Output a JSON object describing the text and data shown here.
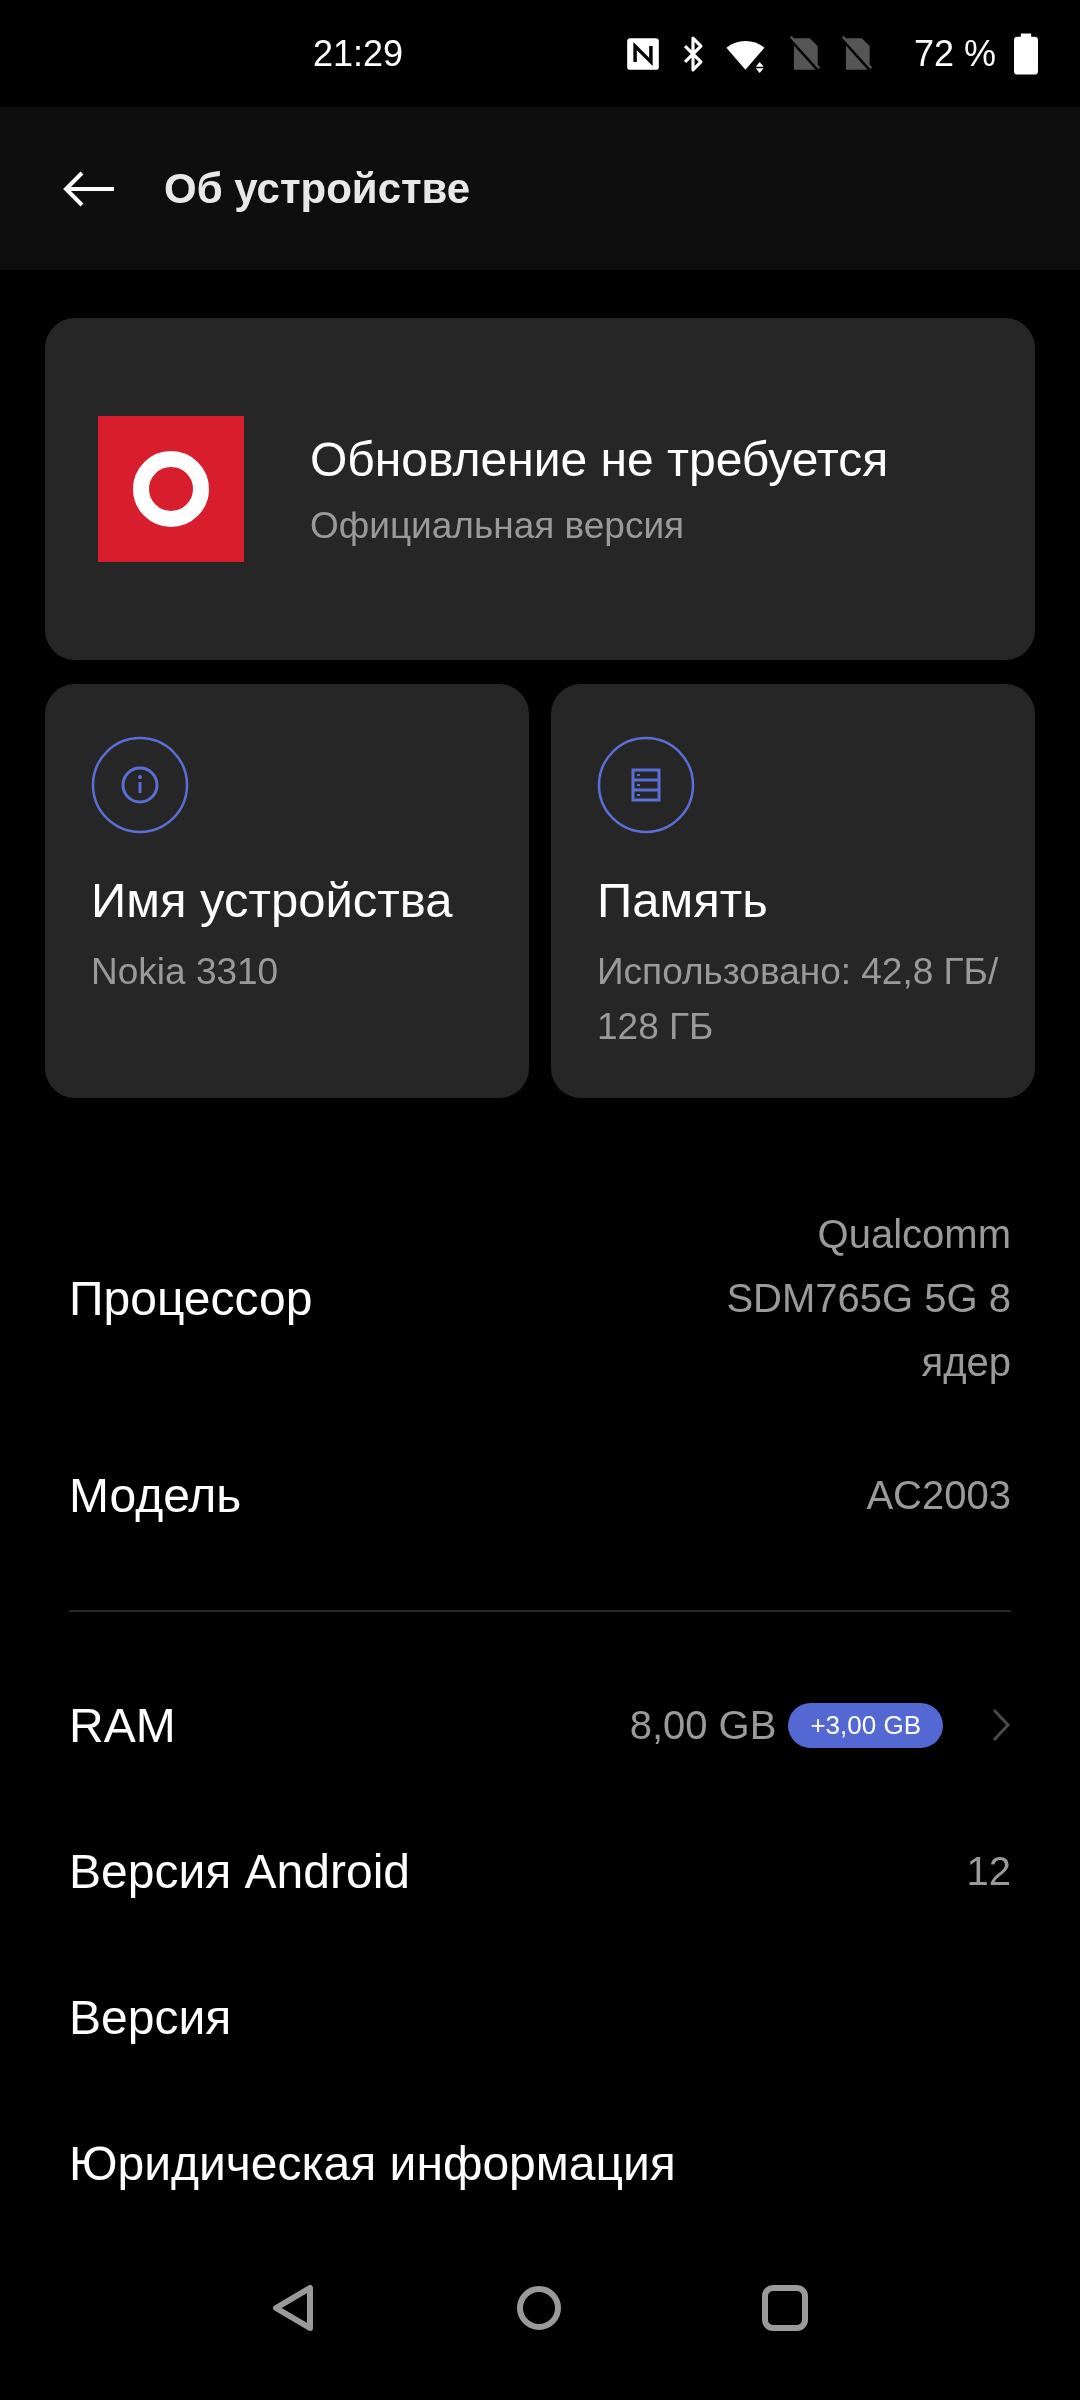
{
  "status_bar": {
    "time": "21:29",
    "battery": "72 %"
  },
  "header": {
    "title": "Об устройстве"
  },
  "update_card": {
    "title": "Обновление не требуется",
    "subtitle": "Официальная версия"
  },
  "cards": [
    {
      "kind": "info",
      "title": "Имя устройства",
      "value": "Nokia 3310"
    },
    {
      "kind": "storage",
      "title": "Память",
      "value": "Использовано: 42,8 ГБ/ 128 ГБ"
    }
  ],
  "sections": [
    {
      "rows": [
        {
          "label": "Процессор",
          "value": "Qualcomm SDM765G 5G 8 ядер",
          "chevron": false
        },
        {
          "label": "Модель",
          "value": "AC2003",
          "chevron": false
        }
      ]
    },
    {
      "rows": [
        {
          "label": "RAM",
          "value": "8,00 GB",
          "badge": "+3,00 GB",
          "chevron": true
        },
        {
          "label": "Версия Android",
          "value": "12",
          "chevron": false
        },
        {
          "label": "Версия",
          "chevron": false
        },
        {
          "label": "Юридическая информация",
          "chevron": false
        }
      ]
    }
  ]
}
